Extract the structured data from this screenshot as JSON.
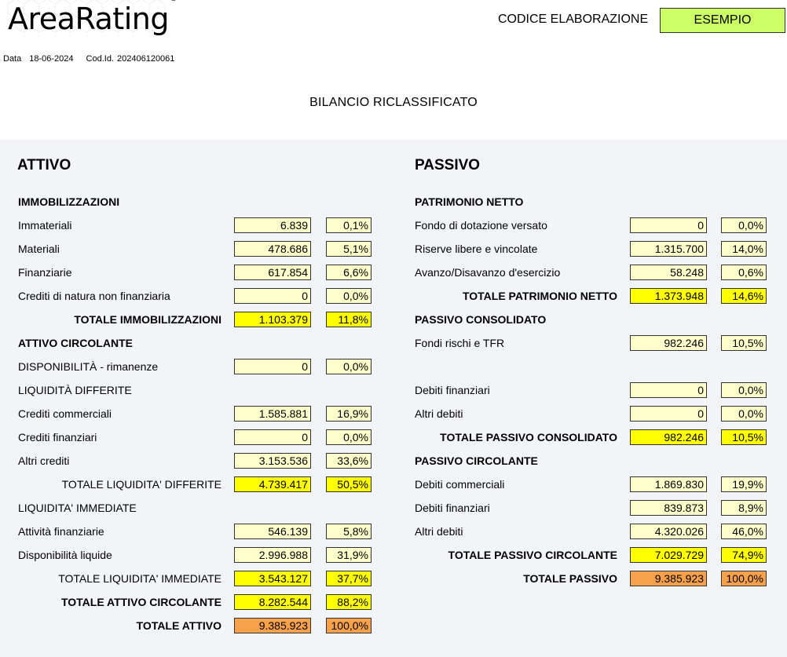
{
  "header": {
    "logo": "AreaRating",
    "logo_mark": "®",
    "codice_label": "CODICE ELABORAZIONE",
    "codice_value": "ESEMPIO",
    "data_label": "Data",
    "data_value": "18-06-2024",
    "codid_label": "Cod.Id.",
    "codid_value": "202406120061",
    "title": "BILANCIO RICLASSIFICATO"
  },
  "colors": {
    "light": "#ffffcc",
    "total": "#ffff00",
    "grand_total": "#f9a14a",
    "codice_bg": "#ccff66"
  },
  "attivo": {
    "heading": "ATTIVO",
    "rows": [
      {
        "label": "IMMOBILIZZAZIONI",
        "kind": "section"
      },
      {
        "label": "Immateriali",
        "value": "6.839",
        "pct": "0,1%",
        "kind": "item"
      },
      {
        "label": "Materiali",
        "value": "478.686",
        "pct": "5,1%",
        "kind": "item"
      },
      {
        "label": "Finanziarie",
        "value": "617.854",
        "pct": "6,6%",
        "kind": "item"
      },
      {
        "label": "Crediti di natura non finanziaria",
        "value": "0",
        "pct": "0,0%",
        "kind": "item"
      },
      {
        "label": "TOTALE IMMOBILIZZAZIONI",
        "value": "1.103.379",
        "pct": "11,8%",
        "kind": "total"
      },
      {
        "label": "ATTIVO CIRCOLANTE",
        "kind": "section"
      },
      {
        "label": "DISPONIBILITÀ - rimanenze",
        "value": "0",
        "pct": "0,0%",
        "kind": "item"
      },
      {
        "label": "LIQUIDITÀ DIFFERITE",
        "kind": "subsection"
      },
      {
        "label": "Crediti commerciali",
        "value": "1.585.881",
        "pct": "16,9%",
        "kind": "item"
      },
      {
        "label": "Crediti finanziari",
        "value": "0",
        "pct": "0,0%",
        "kind": "item"
      },
      {
        "label": "Altri crediti",
        "value": "3.153.536",
        "pct": "33,6%",
        "kind": "item"
      },
      {
        "label": "TOTALE LIQUIDITA' DIFFERITE",
        "value": "4.739.417",
        "pct": "50,5%",
        "kind": "subtotal"
      },
      {
        "label": "LIQUIDITA' IMMEDIATE",
        "kind": "subsection"
      },
      {
        "label": "Attività finanziarie",
        "value": "546.139",
        "pct": "5,8%",
        "kind": "item"
      },
      {
        "label": "Disponibilità liquide",
        "value": "2.996.988",
        "pct": "31,9%",
        "kind": "item"
      },
      {
        "label": "TOTALE LIQUIDITA' IMMEDIATE",
        "value": "3.543.127",
        "pct": "37,7%",
        "kind": "subtotal"
      },
      {
        "label": "TOTALE ATTIVO CIRCOLANTE",
        "value": "8.282.544",
        "pct": "88,2%",
        "kind": "total"
      },
      {
        "label": "TOTALE ATTIVO",
        "value": "9.385.923",
        "pct": "100,0%",
        "kind": "grand"
      }
    ]
  },
  "passivo": {
    "heading": "PASSIVO",
    "rows": [
      {
        "label": "PATRIMONIO NETTO",
        "kind": "section"
      },
      {
        "label": "Fondo di dotazione versato",
        "value": "0",
        "pct": "0,0%",
        "kind": "item"
      },
      {
        "label": "Riserve libere e vincolate",
        "value": "1.315.700",
        "pct": "14,0%",
        "kind": "item"
      },
      {
        "label": "Avanzo/Disavanzo d'esercizio",
        "value": "58.248",
        "pct": "0,6%",
        "kind": "item"
      },
      {
        "label": "TOTALE PATRIMONIO NETTO",
        "value": "1.373.948",
        "pct": "14,6%",
        "kind": "total"
      },
      {
        "label": "PASSIVO CONSOLIDATO",
        "kind": "section"
      },
      {
        "label": "Fondi rischi e TFR",
        "value": "982.246",
        "pct": "10,5%",
        "kind": "item"
      },
      {
        "label": "",
        "kind": "blank"
      },
      {
        "label": "Debiti finanziari",
        "value": "0",
        "pct": "0,0%",
        "kind": "item"
      },
      {
        "label": "Altri debiti",
        "value": "0",
        "pct": "0,0%",
        "kind": "item"
      },
      {
        "label": "TOTALE PASSIVO CONSOLIDATO",
        "value": "982.246",
        "pct": "10,5%",
        "kind": "total"
      },
      {
        "label": "PASSIVO CIRCOLANTE",
        "kind": "section"
      },
      {
        "label": "Debiti commerciali",
        "value": "1.869.830",
        "pct": "19,9%",
        "kind": "item"
      },
      {
        "label": "Debiti finanziari",
        "value": "839.873",
        "pct": "8,9%",
        "kind": "item"
      },
      {
        "label": "Altri debiti",
        "value": "4.320.026",
        "pct": "46,0%",
        "kind": "item"
      },
      {
        "label": "TOTALE PASSIVO CIRCOLANTE",
        "value": "7.029.729",
        "pct": "74,9%",
        "kind": "total"
      },
      {
        "label": "TOTALE PASSIVO",
        "value": "9.385.923",
        "pct": "100,0%",
        "kind": "grand"
      }
    ]
  }
}
